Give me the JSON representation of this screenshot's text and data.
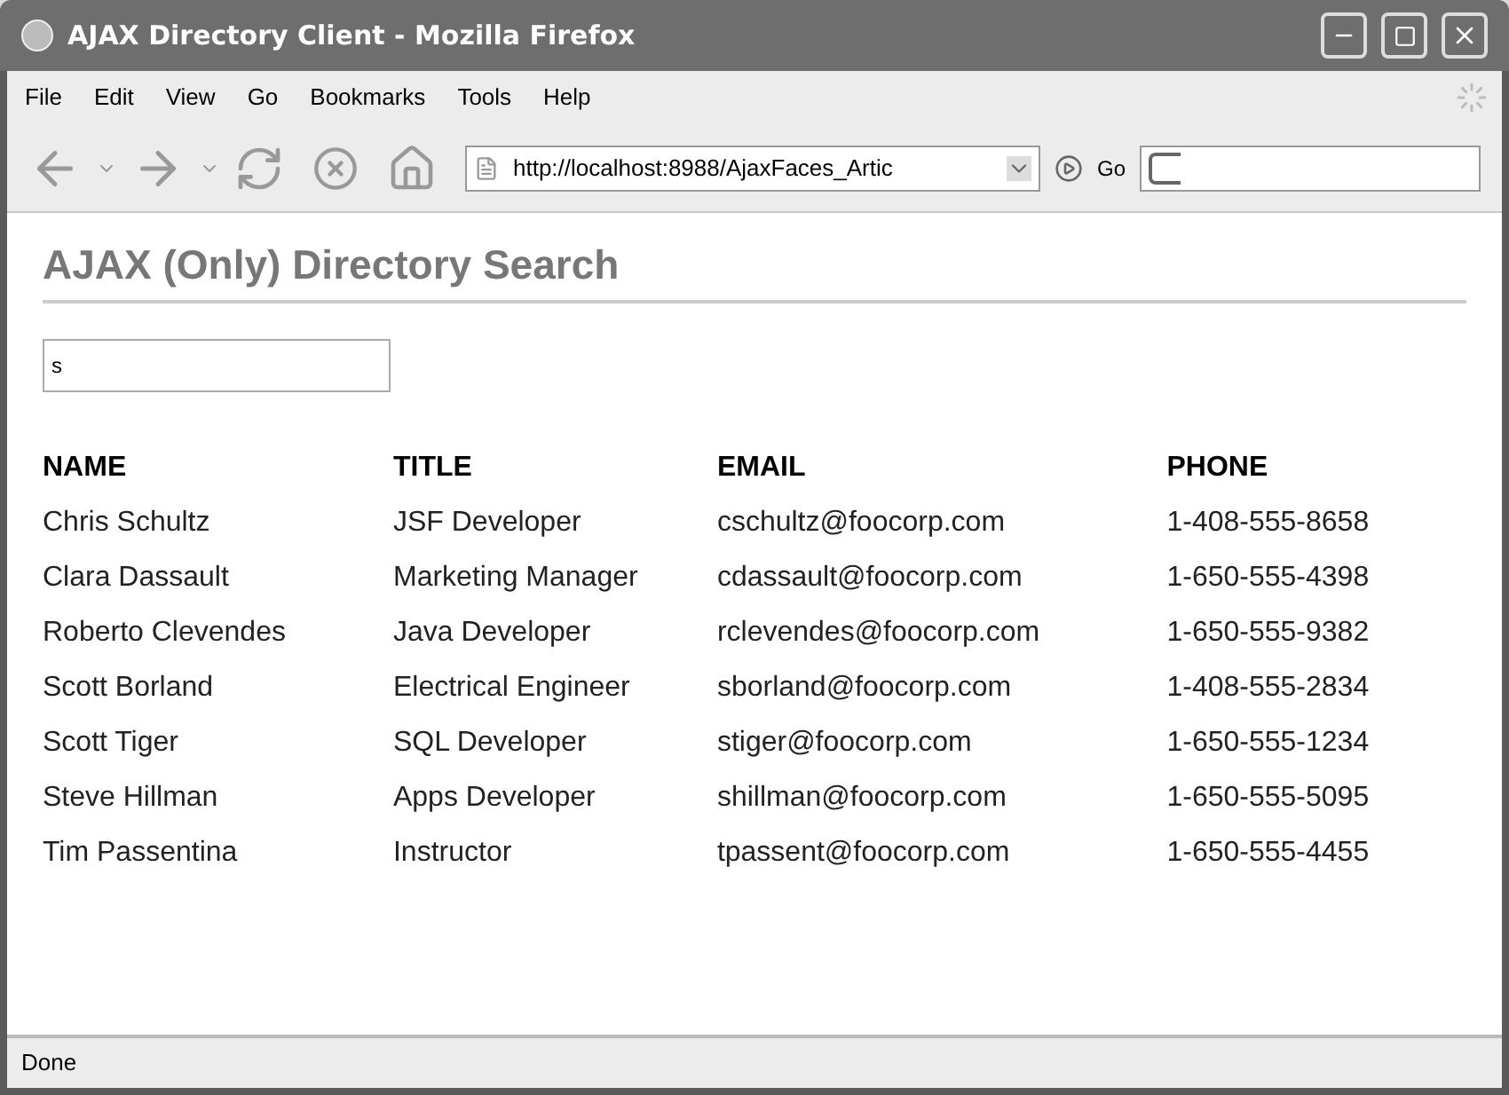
{
  "window": {
    "title": "AJAX Directory Client - Mozilla Firefox"
  },
  "menu": [
    "File",
    "Edit",
    "View",
    "Go",
    "Bookmarks",
    "Tools",
    "Help"
  ],
  "toolbar": {
    "url": "http://localhost:8988/AjaxFaces_Artic",
    "go": "Go"
  },
  "page": {
    "heading": "AJAX (Only) Directory Search",
    "search": {
      "value": "s"
    }
  },
  "table": {
    "columns": [
      "NAME",
      "TITLE",
      "EMAIL",
      "PHONE"
    ],
    "rows": [
      [
        "Chris Schultz",
        "JSF Developer",
        "cschultz@foocorp.com",
        "1-408-555-8658"
      ],
      [
        "Clara Dassault",
        "Marketing Manager",
        "cdassault@foocorp.com",
        "1-650-555-4398"
      ],
      [
        "Roberto Clevendes",
        "Java Developer",
        "rclevendes@foocorp.com",
        "1-650-555-9382"
      ],
      [
        "Scott Borland",
        "Electrical Engineer",
        "sborland@foocorp.com",
        "1-408-555-2834"
      ],
      [
        "Scott Tiger",
        "SQL Developer",
        "stiger@foocorp.com",
        "1-650-555-1234"
      ],
      [
        "Steve Hillman",
        "Apps Developer",
        "shillman@foocorp.com",
        "1-650-555-5095"
      ],
      [
        "Tim Passentina",
        "Instructor",
        "tpassent@foocorp.com",
        "1-650-555-4455"
      ]
    ]
  },
  "status_bar": {
    "text": "Done"
  }
}
